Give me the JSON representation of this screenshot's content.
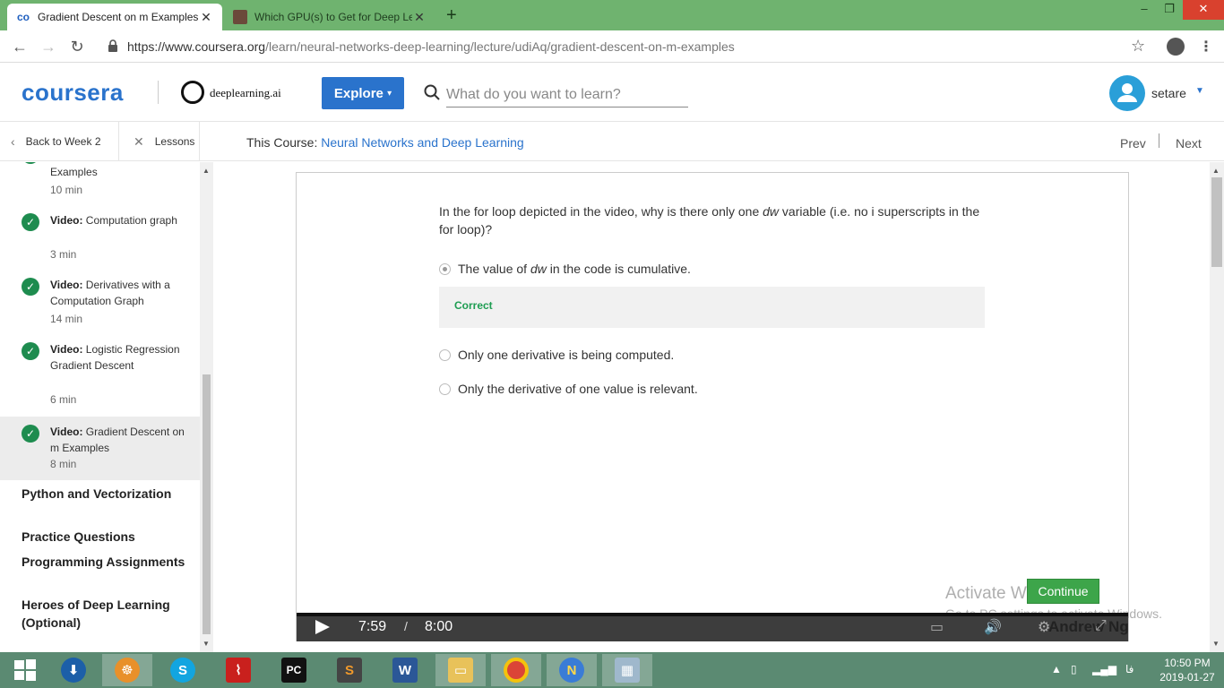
{
  "browser": {
    "tabs": [
      {
        "title": "Gradient Descent on m Examples",
        "active": true
      },
      {
        "title": "Which GPU(s) to Get for Deep Le",
        "active": false
      }
    ],
    "url_host": "https://www.coursera.org",
    "url_path": "/learn/neural-networks-deep-learning/lecture/udiAq/gradient-descent-on-m-examples"
  },
  "header": {
    "logo": "coursera",
    "partner": "deeplearning.ai",
    "explore_label": "Explore",
    "search_placeholder": "What do you want to learn?",
    "username": "setare"
  },
  "course_nav": {
    "back_label": "Back to Week 2",
    "lessons_label": "Lessons",
    "course_prefix": "This Course:",
    "course_name": "Neural Networks and Deep Learning",
    "prev_label": "Prev",
    "next_label": "Next"
  },
  "sidebar": {
    "partial_item": {
      "title": "Examples",
      "duration": "10 min"
    },
    "items": [
      {
        "kind": "Video:",
        "title": "Computation graph",
        "duration": "3 min"
      },
      {
        "kind": "Video:",
        "title": "Derivatives with a Computation Graph",
        "duration": "14 min"
      },
      {
        "kind": "Video:",
        "title": "Logistic Regression Gradient Descent",
        "duration": "6 min"
      },
      {
        "kind": "Video:",
        "title": "Gradient Descent on m Examples",
        "duration": "8 min"
      }
    ],
    "sections": [
      "Python and Vectorization",
      "Practice Questions",
      "Programming Assignments",
      "Heroes of Deep Learning (Optional)"
    ]
  },
  "quiz": {
    "question_a": "In the for loop depicted in the video, why is there only one ",
    "question_em": "dw",
    "question_b": " variable (i.e. no i superscripts in the for loop)?",
    "options": [
      {
        "a": "The value of ",
        "em": "dw",
        "b": " in the code is cumulative.",
        "selected": true
      },
      {
        "a": "Only one derivative is being computed.",
        "em": "",
        "b": "",
        "selected": false
      },
      {
        "a": "Only the derivative of one value is relevant.",
        "em": "",
        "b": "",
        "selected": false
      }
    ],
    "feedback": "Correct",
    "continue_label": "Continue"
  },
  "watermark": {
    "line1": "Activate Windows",
    "line2": "Go to PC settings to activate Windows."
  },
  "video": {
    "current_time": "7:59",
    "separator": "/",
    "duration": "8:00",
    "overlay_text": "Andrew Ng"
  },
  "taskbar": {
    "time": "10:50 PM",
    "date": "2019-01-27",
    "lang": "فا"
  },
  "colors": {
    "brand": "#2a73cc",
    "success": "#1e8c4f",
    "tabstrip": "#6fb36f",
    "taskbar": "#5b8a72"
  }
}
